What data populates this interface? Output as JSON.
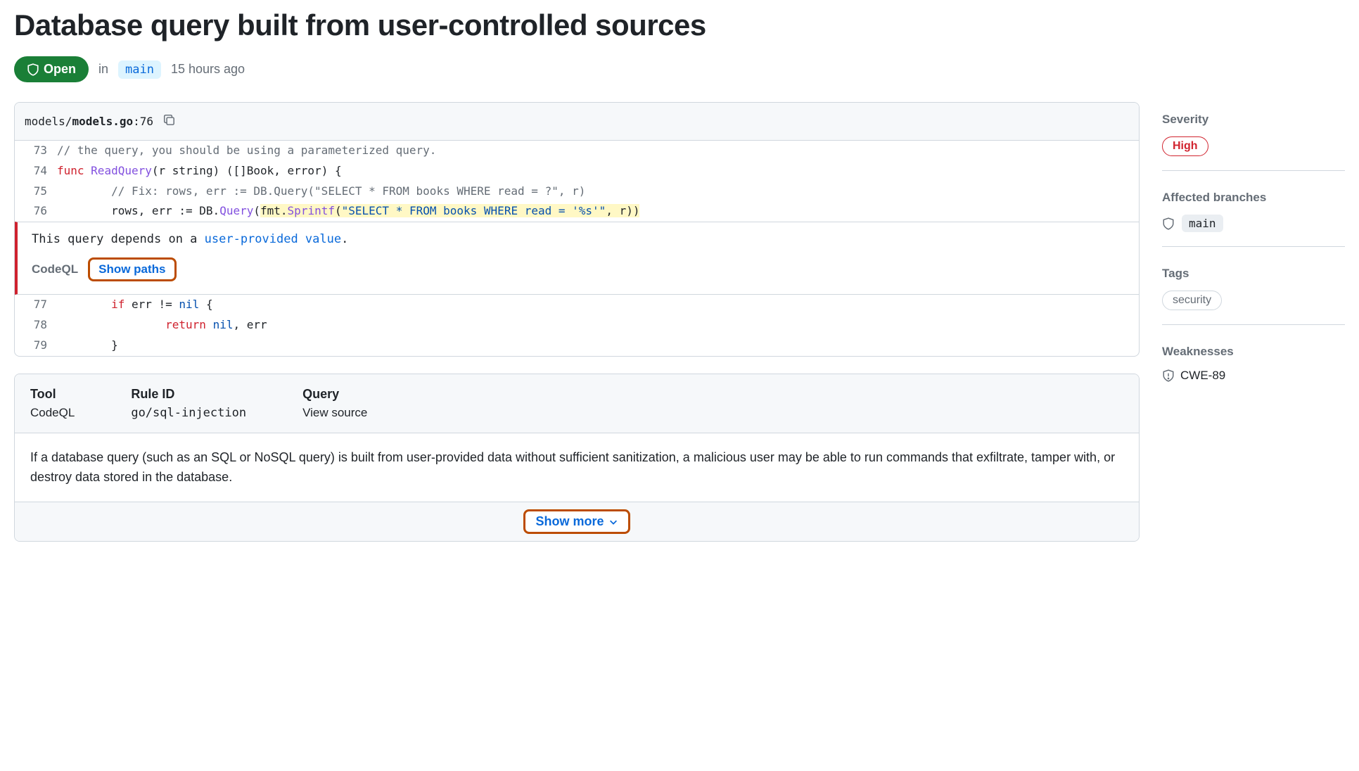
{
  "title": "Database query built from user-controlled sources",
  "status": {
    "label": "Open",
    "in": "in",
    "branch": "main",
    "time": "15 hours ago"
  },
  "file": {
    "path_prefix": "models/",
    "path_name": "models.go",
    "line_suffix": ":76"
  },
  "code": {
    "l73": {
      "num": "73",
      "comment": "// the query, you should be using a parameterized query."
    },
    "l74": {
      "num": "74",
      "kw": "func ",
      "fn": "ReadQuery",
      "rest": "(r string) ([]Book, error) {"
    },
    "l75": {
      "num": "75",
      "indent": "        ",
      "comment": "// Fix: rows, err := DB.Query(\"SELECT * FROM books WHERE read = ?\", r)"
    },
    "l76": {
      "num": "76",
      "indent": "        ",
      "pre": "rows, err := DB.",
      "m1": "Query",
      "p1": "(",
      "m2": "fmt",
      "dot": ".",
      "m3": "Sprintf",
      "p2": "(",
      "str": "\"SELECT * FROM books WHERE read = '%s'\"",
      "tail": ", r))"
    },
    "l77": {
      "num": "77",
      "indent": "        ",
      "kw": "if ",
      "rest1": "err != ",
      "nil": "nil",
      "rest2": " {"
    },
    "l78": {
      "num": "78",
      "indent": "                ",
      "kw": "return ",
      "nil": "nil",
      "rest": ", err"
    },
    "l79": {
      "num": "79",
      "indent": "        ",
      "rest": "}"
    }
  },
  "alert": {
    "msg_pre": "This query depends on a ",
    "msg_link": "user-provided value",
    "msg_post": ".",
    "tool": "CodeQL",
    "show_paths": "Show paths"
  },
  "info": {
    "tool_label": "Tool",
    "tool_value": "CodeQL",
    "rule_label": "Rule ID",
    "rule_value": "go/sql-injection",
    "query_label": "Query",
    "query_value": "View source"
  },
  "description": "If a database query (such as an SQL or NoSQL query) is built from user-provided data without sufficient sanitization, a malicious user may be able to run commands that exfiltrate, tamper with, or destroy data stored in the database.",
  "show_more": "Show more",
  "sidebar": {
    "severity_label": "Severity",
    "severity_value": "High",
    "branches_label": "Affected branches",
    "branches_value": "main",
    "tags_label": "Tags",
    "tags_value": "security",
    "weak_label": "Weaknesses",
    "weak_value": "CWE-89"
  }
}
